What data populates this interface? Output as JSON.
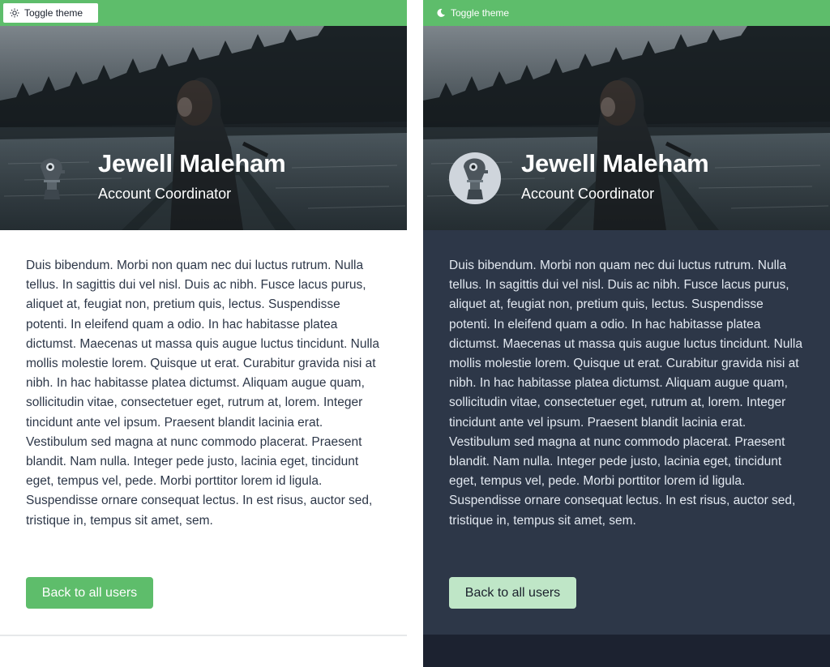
{
  "colors": {
    "accent": "#5ebd6b",
    "dark_bg": "#2d3748",
    "dark_button": "#bfe6c7"
  },
  "panels": [
    {
      "theme": "light",
      "toggle": {
        "label": "Toggle theme",
        "icon": "sun-icon"
      },
      "profile": {
        "name": "Jewell Maleham",
        "title": "Account Coordinator"
      },
      "bio": "Duis bibendum. Morbi non quam nec dui luctus rutrum. Nulla tellus. In sagittis dui vel nisl. Duis ac nibh. Fusce lacus purus, aliquet at, feugiat non, pretium quis, lectus. Suspendisse potenti. In eleifend quam a odio. In hac habitasse platea dictumst. Maecenas ut massa quis augue luctus tincidunt. Nulla mollis molestie lorem. Quisque ut erat. Curabitur gravida nisi at nibh. In hac habitasse platea dictumst. Aliquam augue quam, sollicitudin vitae, consectetuer eget, rutrum at, lorem. Integer tincidunt ante vel ipsum. Praesent blandit lacinia erat. Vestibulum sed magna at nunc commodo placerat. Praesent blandit. Nam nulla. Integer pede justo, lacinia eget, tincidunt eget, tempus vel, pede. Morbi porttitor lorem id ligula. Suspendisse ornare consequat lectus. In est risus, auctor sed, tristique in, tempus sit amet, sem.",
      "back_button": "Back to all users"
    },
    {
      "theme": "dark",
      "toggle": {
        "label": "Toggle theme",
        "icon": "moon-icon"
      },
      "profile": {
        "name": "Jewell Maleham",
        "title": "Account Coordinator"
      },
      "bio": "Duis bibendum. Morbi non quam nec dui luctus rutrum. Nulla tellus. In sagittis dui vel nisl. Duis ac nibh. Fusce lacus purus, aliquet at, feugiat non, pretium quis, lectus. Suspendisse potenti. In eleifend quam a odio. In hac habitasse platea dictumst. Maecenas ut massa quis augue luctus tincidunt. Nulla mollis molestie lorem. Quisque ut erat. Curabitur gravida nisi at nibh. In hac habitasse platea dictumst. Aliquam augue quam, sollicitudin vitae, consectetuer eget, rutrum at, lorem. Integer tincidunt ante vel ipsum. Praesent blandit lacinia erat. Vestibulum sed magna at nunc commodo placerat. Praesent blandit. Nam nulla. Integer pede justo, lacinia eget, tincidunt eget, tempus vel, pede. Morbi porttitor lorem id ligula. Suspendisse ornare consequat lectus. In est risus, auctor sed, tristique in, tempus sit amet, sem.",
      "back_button": "Back to all users"
    }
  ]
}
